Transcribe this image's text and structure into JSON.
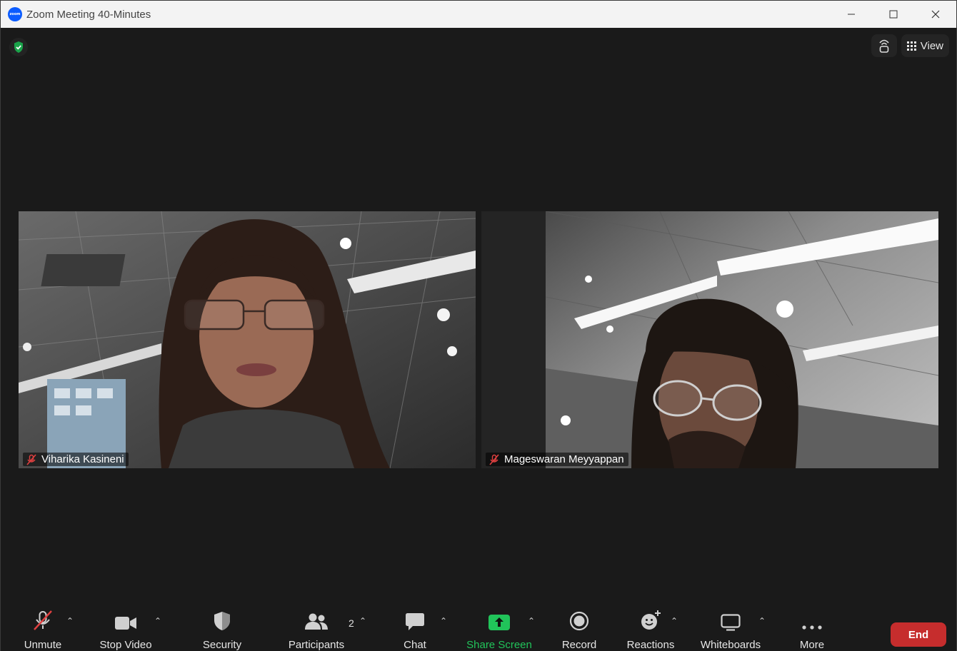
{
  "window": {
    "title": "Zoom Meeting 40-Minutes",
    "app_icon_text": "zoom"
  },
  "header": {
    "view_label": "View"
  },
  "participants": [
    {
      "name": "Viharika Kasineni",
      "muted": true
    },
    {
      "name": "Mageswaran Meyyappan",
      "muted": true
    }
  ],
  "toolbar": {
    "unmute": "Unmute",
    "stop_video": "Stop Video",
    "security": "Security",
    "participants": "Participants",
    "participants_count": "2",
    "chat": "Chat",
    "share_screen": "Share Screen",
    "record": "Record",
    "reactions": "Reactions",
    "whiteboards": "Whiteboards",
    "more": "More",
    "end": "End"
  },
  "colors": {
    "share_green": "#21c45a",
    "end_red": "#c62d2d",
    "shield_green": "#1aa34a",
    "zoom_blue": "#0b5cff"
  }
}
